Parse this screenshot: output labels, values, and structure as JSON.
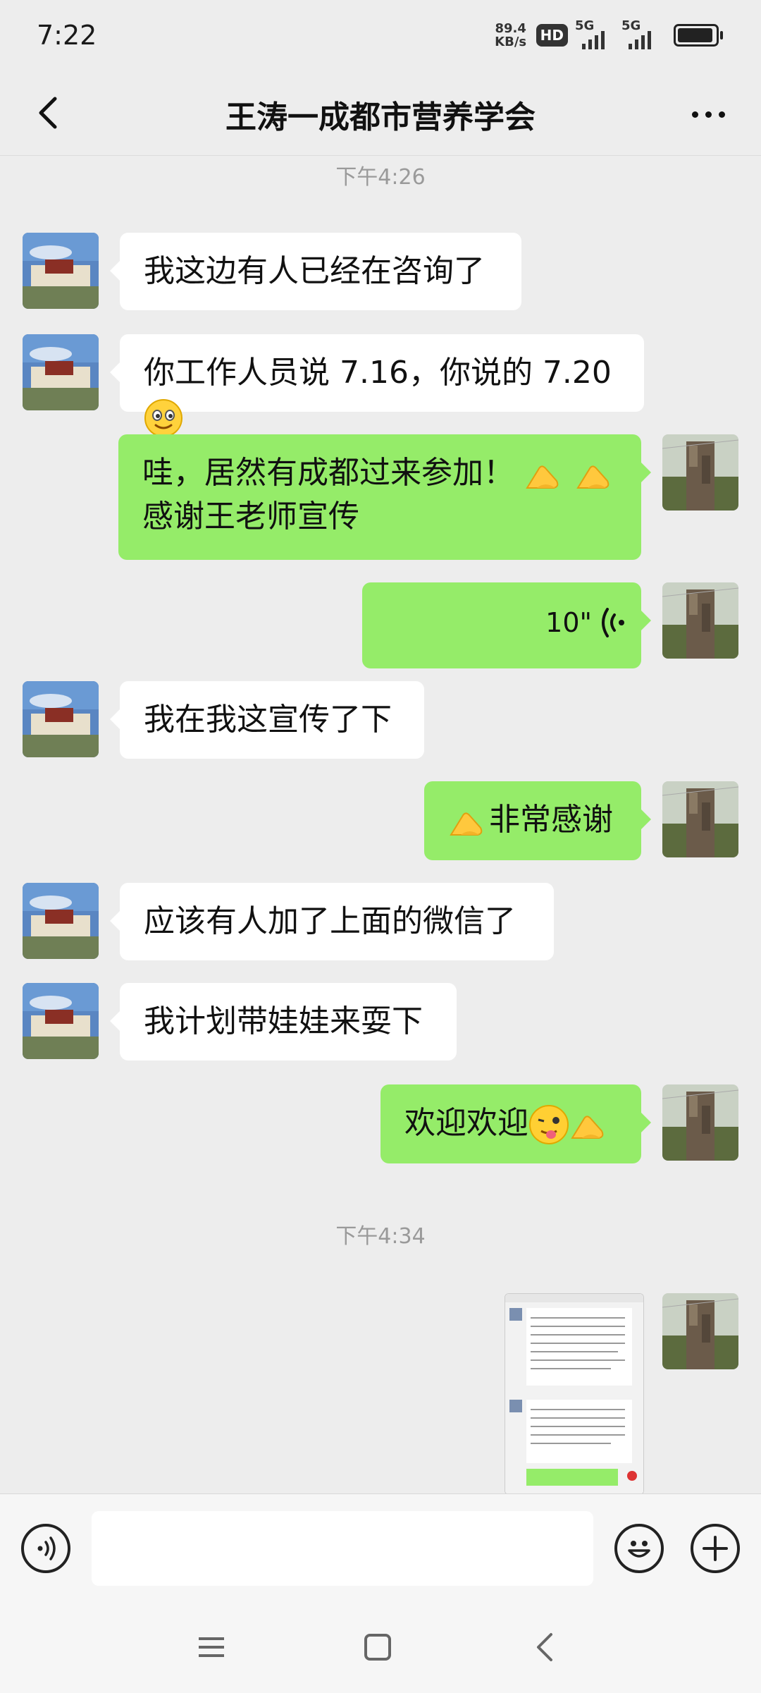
{
  "status_bar": {
    "time": "7:22",
    "net_speed_value": "89.4",
    "net_speed_unit": "KB/s",
    "hd_label": "HD",
    "sim1_label": "5G",
    "sim2_label": "5G",
    "battery_level": 0.95
  },
  "header": {
    "title": "王涛一成都市营养学会",
    "back_icon": "chevron-left-icon",
    "more_icon": "more-dots-icon"
  },
  "messages": [
    {
      "type": "timestamp",
      "text": "下午4:26"
    },
    {
      "type": "text",
      "side": "in",
      "text": "我这边有人已经在咨询了"
    },
    {
      "type": "text",
      "side": "in",
      "text": "你工作人员说 7.16，你说的 7.20",
      "emoji": [
        "smile-emoji"
      ]
    },
    {
      "type": "text",
      "side": "out",
      "line1": "哇，居然有成都过来参加！",
      "line2": "感谢王老师宣传",
      "emoji": [
        "ok-hand-emoji",
        "ok-hand-emoji"
      ]
    },
    {
      "type": "voice",
      "side": "out",
      "duration": "10\""
    },
    {
      "type": "text",
      "side": "in",
      "text": "我在我这宣传了下"
    },
    {
      "type": "text",
      "side": "out",
      "text": "非常感谢",
      "emoji": [
        "ok-hand-emoji"
      ]
    },
    {
      "type": "text",
      "side": "in",
      "text": "应该有人加了上面的微信了"
    },
    {
      "type": "text",
      "side": "in",
      "text": "我计划带娃娃来耍下"
    },
    {
      "type": "text",
      "side": "out",
      "text": "欢迎欢迎",
      "emoji": [
        "wink-tongue-emoji",
        "ok-hand-emoji"
      ]
    },
    {
      "type": "timestamp",
      "text": "下午4:34"
    },
    {
      "type": "image",
      "side": "out",
      "content": "chat-screenshot-thumbnail"
    }
  ],
  "input_bar": {
    "voice_icon": "voice-input-icon",
    "input_value": "",
    "emoji_icon": "emoji-icon",
    "plus_icon": "plus-icon"
  },
  "nav_bar": {
    "menu_icon": "menu-icon",
    "home_icon": "home-square-icon",
    "back_icon": "back-triangle-icon"
  }
}
